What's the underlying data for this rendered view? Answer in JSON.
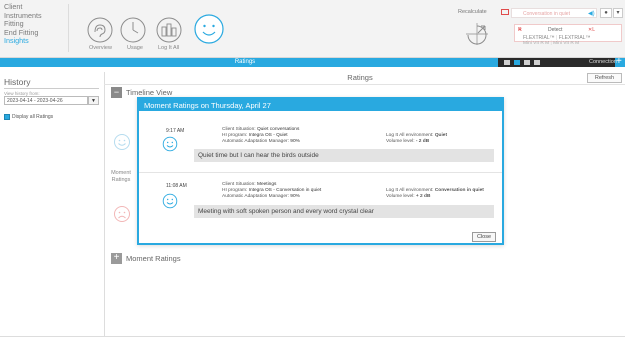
{
  "nav": {
    "items": [
      {
        "label": "Client"
      },
      {
        "label": "Instruments"
      },
      {
        "label": "Fitting"
      },
      {
        "label": "End Fitting"
      },
      {
        "label": "Insights"
      }
    ],
    "active": "Insights"
  },
  "toolbar": {
    "overview_label": "Overview",
    "usage_label": "Usage",
    "logitall_label": "Log It All",
    "recalculate_label": "Recalculate"
  },
  "top_right": {
    "program_placeholder": "Conversation in quiet",
    "detect_label": "Detect",
    "left_side": "R",
    "right_side": "L",
    "device_left": "FLEXTRIAL™",
    "device_right": "FLEXTRIAL™",
    "model_left": "Mini VII R M",
    "model_right": "Mini VII R M",
    "connection_label": "Connection"
  },
  "bluebar": {
    "title": "Ratings"
  },
  "sidebar": {
    "title": "History",
    "view_history_label": "View history from:",
    "date_range": "2023-04-14 - 2023-04-26",
    "display_all_label": "Display all Ratings"
  },
  "main": {
    "title": "Ratings",
    "refresh_label": "Refresh",
    "timeline_label": "Timeline View",
    "moment_side_label": "Moment Ratings",
    "moment_section_label": "Moment Ratings"
  },
  "dialog": {
    "title": "Moment Ratings on Thursday, April 27",
    "close_label": "Close",
    "entries": [
      {
        "time": "9:17 AM",
        "situation_label": "Client Situation:",
        "situation": "Quiet conversations",
        "program_label": "HI program:",
        "program": "Integra OS - Quiet",
        "aam_label": "Automatic Adaptation Manager:",
        "aam": "90%",
        "env_label": "Log It All environment:",
        "env": "Quiet",
        "volume_label": "Volume level:",
        "volume": "- 2 dB",
        "comment": "Quiet time but I can hear the birds outside"
      },
      {
        "time": "11:08 AM",
        "situation_label": "Client Situation:",
        "situation": "Meetings",
        "program_label": "HI program:",
        "program": "Integra OS - Conversation in quiet",
        "aam_label": "Automatic Adaptation Manager:",
        "aam": "90%",
        "env_label": "Log It All environment:",
        "env": "Conversation in quiet",
        "volume_label": "Volume level:",
        "volume": "+ 2 dB",
        "comment": "Meeting with soft spoken person and every word crystal clear"
      }
    ]
  },
  "colors": {
    "accent": "#29a9e0",
    "alert": "#e04b4b",
    "dark": "#2a2a2a"
  },
  "icons": {
    "overview": "ear-icon",
    "usage": "clock-icon",
    "logitall": "bars-icon",
    "current": "smiley-icon",
    "recalculate": "recalculate-icon"
  }
}
